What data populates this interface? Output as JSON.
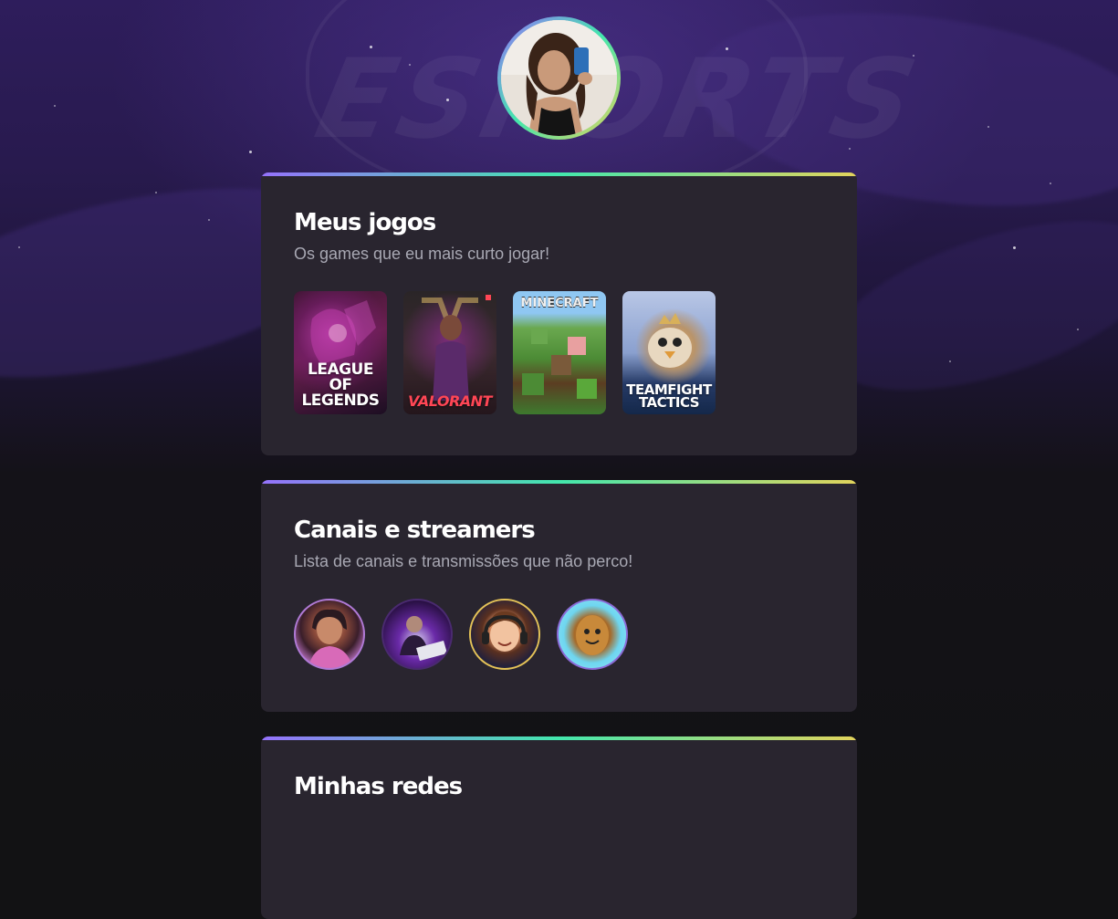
{
  "profile": {
    "avatar_icon": "user-photo-avatar"
  },
  "background": {
    "logo_text": "ESPORTS"
  },
  "games_section": {
    "title": "Meus jogos",
    "subtitle": "Os games que eu mais curto jogar!",
    "games": [
      {
        "title": "LEAGUE OF LEGENDS",
        "icon": "league-of-legends-cover"
      },
      {
        "title": "VALORANT",
        "icon": "valorant-cover"
      },
      {
        "title": "MINECRAFT",
        "icon": "minecraft-cover"
      },
      {
        "title": "TEAMFIGHT TACTICS",
        "icon": "teamfight-tactics-cover"
      }
    ]
  },
  "streamers_section": {
    "title": "Canais e streamers",
    "subtitle": "Lista de canais e transmissões que não perco!",
    "streamers": [
      {
        "icon": "streamer-avatar-1"
      },
      {
        "icon": "streamer-avatar-2"
      },
      {
        "icon": "streamer-avatar-3"
      },
      {
        "icon": "streamer-avatar-4"
      }
    ]
  },
  "socials_section": {
    "title": "Minhas redes"
  },
  "colors": {
    "gradient": [
      "#9572fc",
      "#43e7ad",
      "#e2d45c"
    ],
    "card_bg": "#29252f",
    "page_bg": "#121214"
  }
}
